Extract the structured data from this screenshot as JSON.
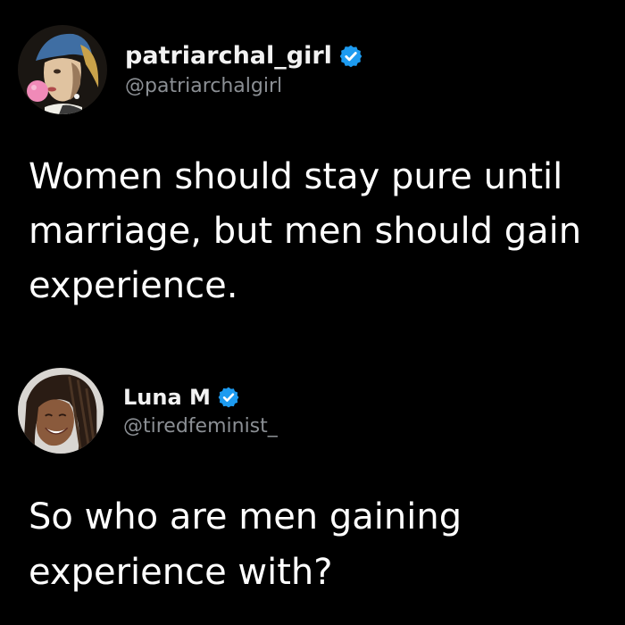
{
  "tweets": [
    {
      "display_name": "patriarchal_girl",
      "handle": "@patriarchalgirl",
      "verified": true,
      "avatar_icon": "girl-with-pearl-earring-bubblegum-avatar",
      "text": "Women should stay pure until marriage, but men should gain experience."
    },
    {
      "display_name": "Luna M",
      "handle": "@tiredfeminist_",
      "verified": true,
      "avatar_icon": "smiling-woman-braids-avatar",
      "text": "So who are men gaining experience with?"
    }
  ],
  "colors": {
    "background": "#000000",
    "text": "#ffffff",
    "handle": "#8b8f94",
    "verified_badge": "#1d9bf0"
  }
}
